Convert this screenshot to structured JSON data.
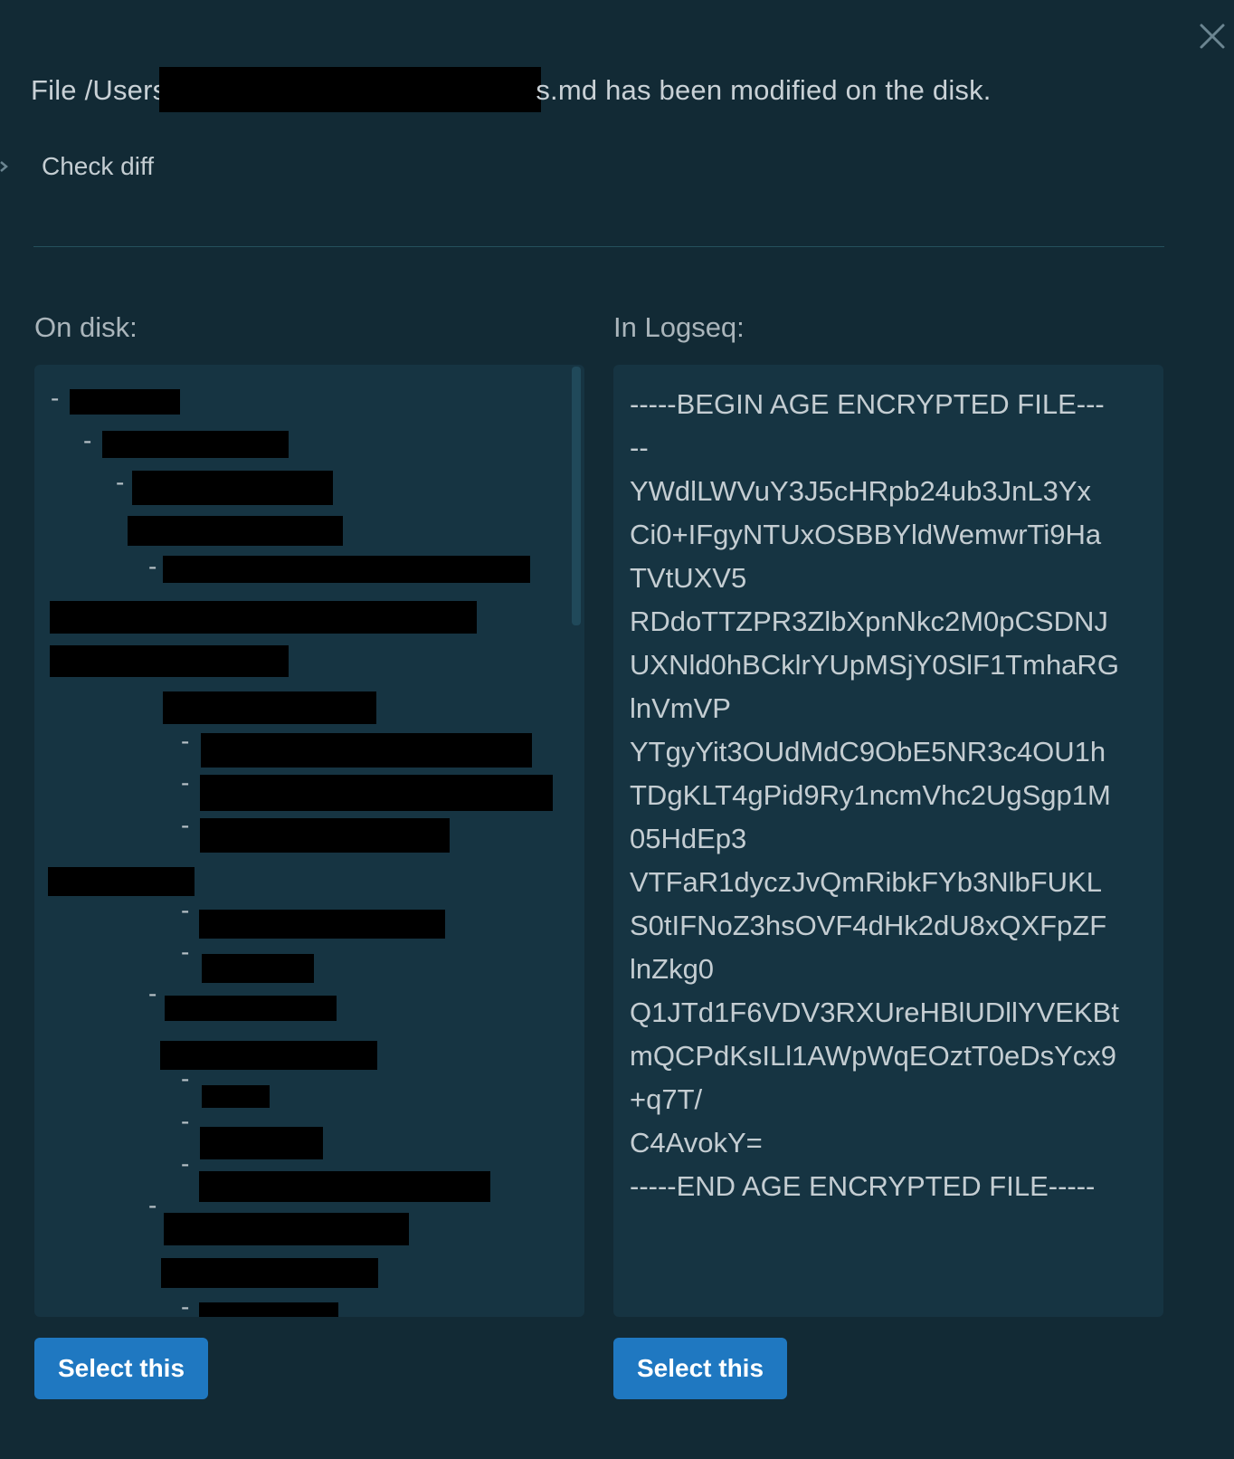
{
  "header": {
    "prefix": "File /Users",
    "suffix": "s.md has been modified on the disk."
  },
  "diff_toggle": {
    "label": "Check diff"
  },
  "left_pane": {
    "label": "On disk:",
    "bullet": "-",
    "button_label": "Select this"
  },
  "right_pane": {
    "label": "In Logseq:",
    "button_label": "Select this",
    "lines": [
      "-----BEGIN AGE ENCRYPTED FILE---",
      "--",
      "YWdlLWVuY3J5cHRpb24ub3JnL3Yx",
      "Ci0+IFgyNTUxOSBBYldWemwrTi9Ha",
      "TVtUXV5",
      "RDdoTTZPR3ZlbXpnNkc2M0pCSDNJ",
      "UXNld0hBCklrYUpMSjY0SlF1TmhaRG",
      "lnVmVP",
      "YTgyYit3OUdMdC9ObE5NR3c4OU1h",
      "TDgKLT4gPid9Ry1ncmVhc2UgSgp1M",
      "05HdEp3",
      "VTFaR1dyczJvQmRibkFYb3NlbFUKL",
      "S0tIFNoZ3hsOVF4dHk2dU8xQXFpZF",
      "lnZkg0",
      "Q1JTd1F6VDV3RXUreHBlUDllYVEKBt",
      "mQCPdKsILl1AWpWqEOztT0eDsYcx9",
      "+q7T/",
      "C4AvokY=",
      "-----END AGE ENCRYPTED FILE-----"
    ]
  },
  "colors": {
    "background": "#122a35",
    "pane": "#163442",
    "button": "#1f78c1",
    "text": "#c4cdd2"
  }
}
